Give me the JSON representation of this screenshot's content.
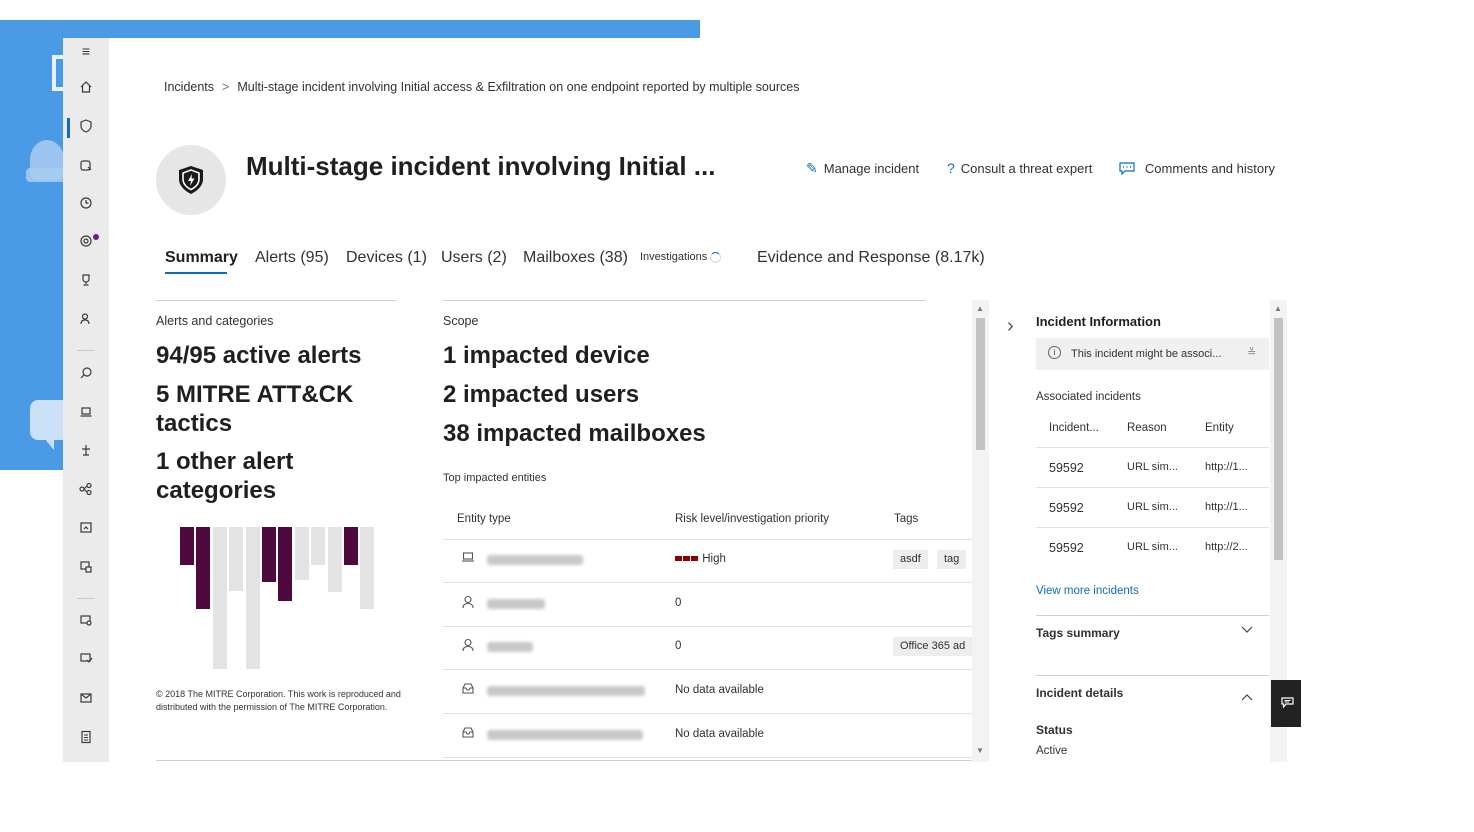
{
  "breadcrumb": {
    "root": "Incidents",
    "current": "Multi-stage incident involving Initial access & Exfiltration on one endpoint reported by multiple sources"
  },
  "header": {
    "title": "Multi-stage incident involving Initial ...",
    "actions": {
      "manage": "Manage incident",
      "consult": "Consult a threat expert",
      "comments": "Comments and history"
    }
  },
  "tabs": [
    {
      "label": "Summary"
    },
    {
      "label": "Alerts (95)"
    },
    {
      "label": "Devices (1)"
    },
    {
      "label": "Users (2)"
    },
    {
      "label": "Mailboxes (38)"
    },
    {
      "label": "Investigations"
    },
    {
      "label": "Evidence and Response (8.17k)"
    }
  ],
  "alerts": {
    "label": "Alerts and categories",
    "line1": "94/95 active alerts",
    "line2a": "5 MITRE ATT&CK",
    "line2b": "tactics",
    "line3a": "1 other alert",
    "line3b": "categories",
    "copyright": "© 2018 The MITRE Corporation. This work is reproduced and distributed with the permission of The MITRE Corporation."
  },
  "scope": {
    "label": "Scope",
    "line1": "1 impacted device",
    "line2": "2 impacted users",
    "line3": "38 impacted mailboxes",
    "top_label": "Top impacted entities",
    "columns": {
      "entity": "Entity type",
      "risk": "Risk level/investigation priority",
      "tags": "Tags"
    },
    "rows": [
      {
        "icon": "laptop-icon",
        "risk": "High",
        "tags": [
          "asdf",
          "tag"
        ]
      },
      {
        "icon": "user-icon",
        "risk": "0",
        "tags": []
      },
      {
        "icon": "user-icon",
        "risk": "0",
        "tags": [
          "Office 365 ad"
        ]
      },
      {
        "icon": "mailbox-icon",
        "risk": "No data available",
        "tags": []
      },
      {
        "icon": "mailbox-icon",
        "risk": "No data available",
        "tags": []
      }
    ]
  },
  "incident_info": {
    "title": "Incident Information",
    "note": "This incident might be associ...",
    "associated_label": "Associated incidents",
    "columns": {
      "incident": "Incident...",
      "reason": "Reason",
      "entity": "Entity"
    },
    "rows": [
      {
        "incident": "59592",
        "reason": "URL sim...",
        "entity": "http://1..."
      },
      {
        "incident": "59592",
        "reason": "URL sim...",
        "entity": "http://1..."
      },
      {
        "incident": "59592",
        "reason": "URL sim...",
        "entity": "http://2..."
      }
    ],
    "view_more": "View more incidents",
    "tags_summary": "Tags summary",
    "details": "Incident details",
    "status_label": "Status",
    "status_value": "Active"
  },
  "colors": {
    "accent": "#0f6cbd",
    "mitre_active": "#4e0a3e",
    "mitre_inactive": "#e3e3e3",
    "risk_high": "#8e0000"
  },
  "mitre_chart": {
    "columns": [
      {
        "active": true,
        "height": 0.27
      },
      {
        "active": true,
        "height": 0.58
      },
      {
        "active": false,
        "height": 1.0
      },
      {
        "active": false,
        "height": 0.45
      },
      {
        "active": false,
        "height": 1.0
      },
      {
        "active": true,
        "height": 0.39
      },
      {
        "active": true,
        "height": 0.52
      },
      {
        "active": false,
        "height": 0.37
      },
      {
        "active": false,
        "height": 0.27
      },
      {
        "active": false,
        "height": 0.46
      },
      {
        "active": true,
        "height": 0.27
      },
      {
        "active": false,
        "height": 0.58
      }
    ]
  }
}
